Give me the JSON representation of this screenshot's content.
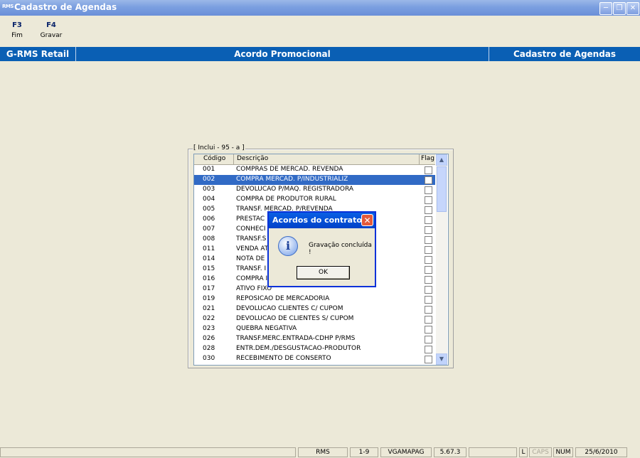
{
  "window": {
    "app_icon": "RMS",
    "title": "Cadastro de Agendas",
    "controls": [
      "minimize",
      "maximize",
      "close"
    ]
  },
  "function_keys": [
    {
      "key": "F3",
      "label": "Fim"
    },
    {
      "key": "F4",
      "label": "Gravar"
    }
  ],
  "header": {
    "left": "G-RMS Retail",
    "center": "Acordo Promocional",
    "right": "Cadastro de Agendas"
  },
  "group": {
    "caption": "[ Inclui - 95 - a ]"
  },
  "list": {
    "columns": {
      "code": "Código",
      "description": "Descrição",
      "flag": "Flag"
    },
    "selected_index": 1,
    "rows": [
      {
        "code": "001",
        "desc": "COMPRAS DE MERCAD. REVENDA"
      },
      {
        "code": "002",
        "desc": "COMPRA MERCAD. P/INDUSTRIALIZ"
      },
      {
        "code": "003",
        "desc": "DEVOLUCAO P/MAQ. REGISTRADORA"
      },
      {
        "code": "004",
        "desc": "COMPRA DE PRODUTOR RURAL"
      },
      {
        "code": "005",
        "desc": "TRANSF. MERCAD. P/REVENDA"
      },
      {
        "code": "006",
        "desc": "PRESTAC"
      },
      {
        "code": "007",
        "desc": "CONHECI"
      },
      {
        "code": "008",
        "desc": "TRANSF.S"
      },
      {
        "code": "011",
        "desc": "VENDA AT"
      },
      {
        "code": "014",
        "desc": "NOTA DE"
      },
      {
        "code": "015",
        "desc": "TRANSF. I"
      },
      {
        "code": "016",
        "desc": "COMPRA I"
      },
      {
        "code": "017",
        "desc": "ATIVO FIXO"
      },
      {
        "code": "019",
        "desc": "REPOSICAO DE MERCADORIA"
      },
      {
        "code": "021",
        "desc": "DEVOLUCAO CLIENTES C/ CUPOM"
      },
      {
        "code": "022",
        "desc": "DEVOLUCAO DE CLIENTES S/ CUPOM"
      },
      {
        "code": "023",
        "desc": "QUEBRA NEGATIVA"
      },
      {
        "code": "026",
        "desc": "TRANSF.MERC.ENTRADA-CDHP P/RMS"
      },
      {
        "code": "028",
        "desc": "ENTR.DEM./DESGUSTACAO-PRODUTOR"
      },
      {
        "code": "030",
        "desc": "RECEBIMENTO DE CONSERTO"
      }
    ]
  },
  "dialog": {
    "title": "Acordos do contrato",
    "message": "Gravação concluída !",
    "ok_label": "OK",
    "icon": "info-icon"
  },
  "status": {
    "cells": [
      "RMS",
      "1-9",
      "VGAMAPAG",
      "5.67.3",
      "",
      "L",
      "CAPS",
      "NUM",
      "25/6/2010"
    ]
  }
}
